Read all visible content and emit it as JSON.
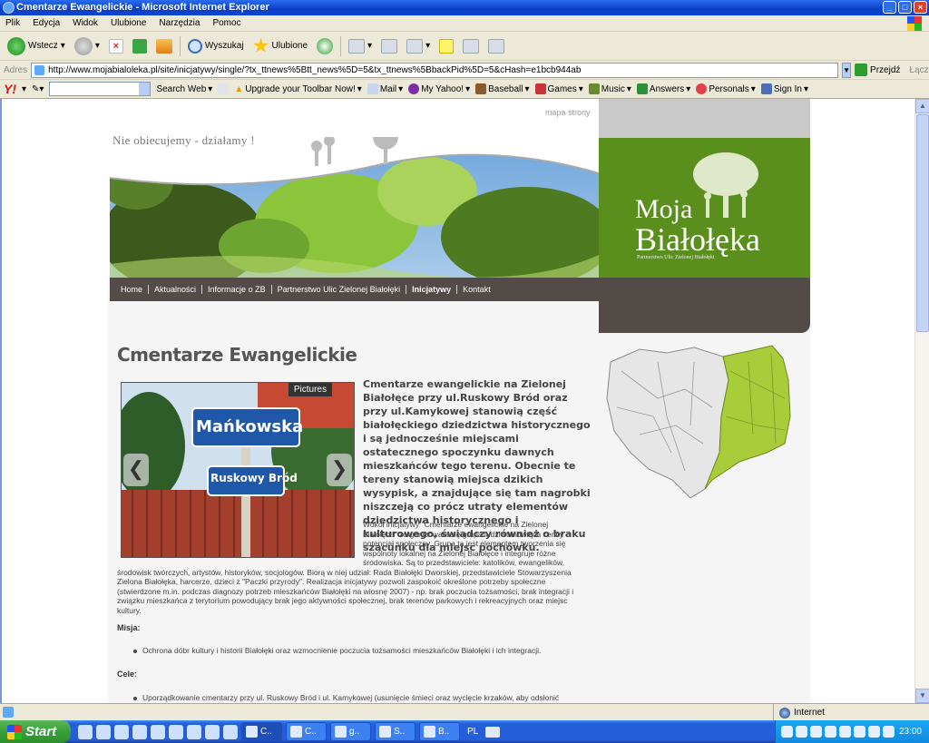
{
  "window": {
    "title": "Cmentarze Ewangelickie - Microsoft Internet Explorer"
  },
  "menu": [
    "Plik",
    "Edycja",
    "Widok",
    "Ulubione",
    "Narzędzia",
    "Pomoc"
  ],
  "toolbar": {
    "back_label": "Wstecz",
    "search_label": "Wyszukaj",
    "favorites_label": "Ulubione"
  },
  "address": {
    "label": "Adres",
    "url": "http://www.mojabialoleka.pl/site/inicjatywy/single/?tx_ttnews%5Btt_news%5D=5&tx_ttnews%5BbackPid%5D=5&cHash=e1bcb944ab",
    "go_label": "Przejdź",
    "links_label": "Łącza"
  },
  "yahoo_toolbar": {
    "logo": "Y!",
    "search_web": "Search Web",
    "upgrade": "Upgrade your Toolbar Now!",
    "mail": "Mail",
    "my_yahoo": "My Yahoo!",
    "baseball": "Baseball",
    "games": "Games",
    "music": "Music",
    "answers": "Answers",
    "personals": "Personals",
    "sign_in": "Sign In"
  },
  "site": {
    "sitemap": "mapa strony",
    "slogan": "Nie obiecujemy - działamy !",
    "logo_line1": "Moja",
    "logo_line2": "Białołęka",
    "logo_sub": "Partnerstwo Ulic Zielonej Białołęki",
    "nav": [
      "Home",
      "Aktualności",
      "Informacje o ZB",
      "Partnerstwo Ulic Zielonej Białołęki",
      "Inicjatywy",
      "Kontakt"
    ],
    "nav_active_index": 4
  },
  "article": {
    "title": "Cmentarze Ewangelickie",
    "slider_badge": "Pictures",
    "sign_top": "Mańkowska",
    "sign_bottom": "Ruskowy Bród",
    "intro": "Cmentarze ewangelickie na Zielonej Białołęce przy ul.Ruskowy Bród oraz przy ul.Kamykowej stanowią część białołęckiego dziedzictwa historycznego i są jednocześnie miejscami ostatecznego spoczynku dawnych mieszkańców tego terenu. Obecnie te tereny stanowią miejsca dzikich wysypisk, a znajdujące się tam nagrobki niszczeją co prócz utraty elementów dziedzictwa historycznego i kulturowego, świadczy również o braku szacunku dla miejsc pochówku.",
    "body_lines": [
      "Wokół inicjatywy \"Cmentarze ewangelickie na Zielonej",
      "Białołęce\" zorganizowała się grupa ludzi stanowiąca cenny",
      "potencjał społeczny. Grupa ta jest elementem tworzenia się",
      "wspólnoty lokalnej na Zielonej Białołęce i integruje różne",
      "środowiska. Są to przedstawiciele: katolików, ewangelików,",
      "środowisk twórczych, artystów, historyków, socjologów. Biorą w niej udział: Rada Białołęki Dworskiej,  przedstawiciele Stowarzyszenia",
      "Zielona Białołęka, harcerze, dzieci z \"Paczki przyrody\".  Realizacja inicjatywy pozwoli zaspokoić określone potrzeby społeczne",
      "(stwierdzone m.in. podczas diagnozy potrzeb mieszkańców Białołęki na wiosnę 2007) - np. brak poczucia tożsamości, brak integracji i",
      "związku mieszkańca z terytorium powodujący brak jego aktywności społecznej, brak terenów parkowych i rekreacyjnych oraz miejsc",
      "kultury."
    ],
    "misja_label": "Misja:",
    "misja_item": "Ochrona dóbr kultury i historii Białołęki oraz wzmocnienie poczucia tożsamości mieszkańców Białołęki i ich integracji.",
    "cele_label": "Cele:",
    "cele_item": "Uporządkowanie cmentarzy przy ul. Ruskowy Bród i ul. Kamykowej (usunięcie śmieci oraz wycięcie krzaków, aby odsłonić"
  },
  "status": {
    "zone": "Internet"
  },
  "taskbar": {
    "start": "Start",
    "tasks": [
      "C..",
      "C..",
      "g..",
      "S..",
      "B.."
    ],
    "lang": "PL",
    "clock": "23:00"
  }
}
